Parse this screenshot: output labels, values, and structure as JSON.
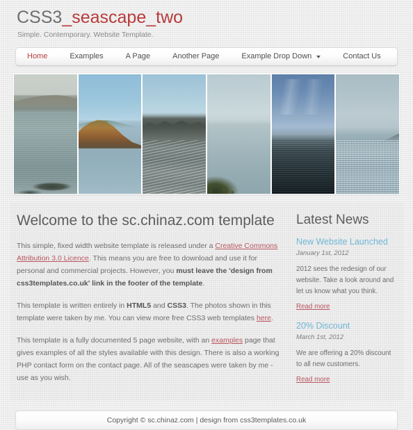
{
  "header": {
    "title_plain": "CSS3",
    "title_accent": "_seascape_two",
    "tagline": "Simple. Contemporary. Website Template.",
    "accent_color": "#b83a3a"
  },
  "nav": {
    "items": [
      {
        "label": "Home",
        "active": true,
        "has_caret": false
      },
      {
        "label": "Examples",
        "active": false,
        "has_caret": false
      },
      {
        "label": "A Page",
        "active": false,
        "has_caret": false
      },
      {
        "label": "Another Page",
        "active": false,
        "has_caret": false
      },
      {
        "label": "Example Drop Down",
        "active": false,
        "has_caret": true
      },
      {
        "label": "Contact Us",
        "active": false,
        "has_caret": false
      }
    ]
  },
  "gallery": {
    "images": [
      {
        "alt": "hazy headland over choppy sea with rock"
      },
      {
        "alt": "ochre cliff above calm blue bay"
      },
      {
        "alt": "dark rocky foreshore with distant coast"
      },
      {
        "alt": "pale misty sea with foliage in foreground"
      },
      {
        "alt": "deep blue sky over dark open sea"
      },
      {
        "alt": "glittering sunlit sea with distant headland"
      }
    ]
  },
  "main": {
    "heading": "Welcome to the sc.chinaz.com template",
    "paragraph1": {
      "part1": "This simple, fixed width website template is released under a ",
      "link1": "Creative Commons Attribution 3.0 Licence",
      "part2": ". This means you are free to download and use it for personal and commercial projects. However, you ",
      "bold1": "must leave the 'design from css3templates.co.uk' link in the footer of the template",
      "part3": "."
    },
    "paragraph2": {
      "part1": "This template is written entirely in ",
      "bold1": "HTML5",
      "part2": " and ",
      "bold2": "CSS3",
      "part3": ". The photos shown in this template were taken by me. You can view more free CSS3 web templates ",
      "link1": "here",
      "part4": "."
    },
    "paragraph3": {
      "part1": "This template is a fully documented 5 page website, with an ",
      "link1": "examples",
      "part2": " page that gives examples of all the styles available with this design. There is also a working PHP contact form on the contact page. All of the seascapes were taken by me - use as you wish."
    }
  },
  "sidebar": {
    "heading": "Latest News",
    "news_title_color": "#6fb7d6",
    "items": [
      {
        "title": "New Website Launched",
        "date": "January 1st, 2012",
        "body": "2012 sees the redesign of our website. Take a look around and let us know what you think.",
        "read_more": "Read more"
      },
      {
        "title": "20% Discount",
        "date": "March 1st, 2012",
        "body": "We are offering a 20% discount to all new customers.",
        "read_more": "Read more"
      }
    ]
  },
  "footer": {
    "text": "Copyright © sc.chinaz.com | design from css3templates.co.uk"
  }
}
